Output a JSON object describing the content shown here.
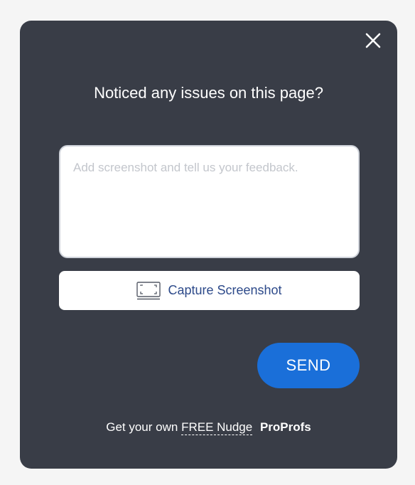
{
  "dialog": {
    "title": "Noticed any issues on this page?",
    "close_icon": "close-icon",
    "feedback_placeholder": "Add screenshot and tell us your feedback.",
    "feedback_value": "",
    "capture_label": "Capture Screenshot",
    "capture_icon": "screenshot-icon",
    "send_label": "SEND"
  },
  "footer": {
    "prefix": "Get your own",
    "link_text": "FREE Nudge",
    "brand": "ProProfs"
  },
  "colors": {
    "page_background": "#f5f5f5",
    "card_background": "#393d47",
    "send_button": "#1a6fd9",
    "capture_label": "#2d4a8a"
  }
}
